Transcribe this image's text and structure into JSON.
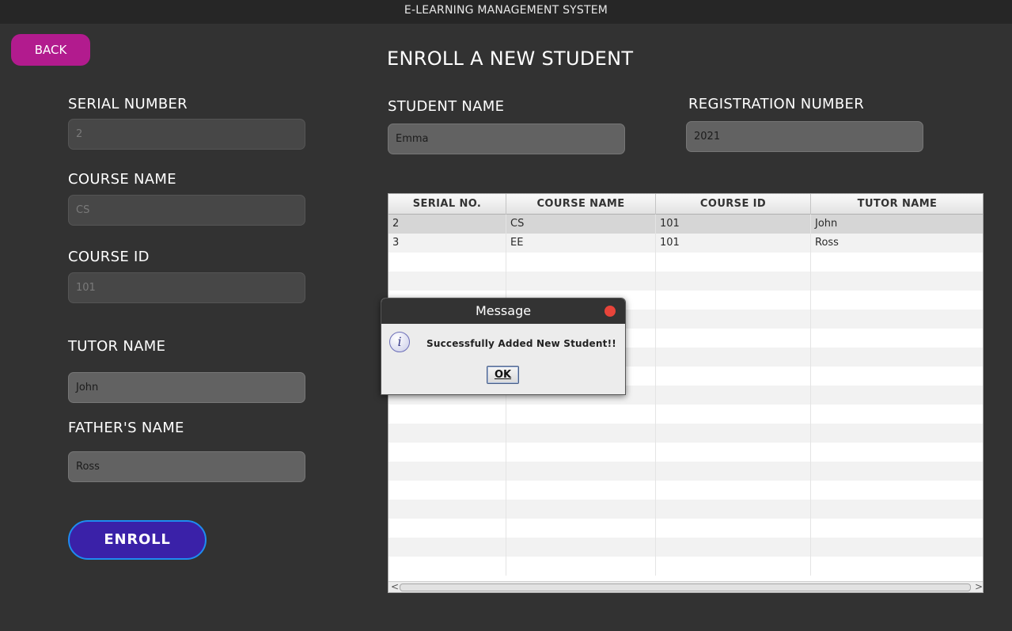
{
  "window": {
    "title": "E-LEARNING MANAGEMENT SYSTEM"
  },
  "back_label": "BACK",
  "page_title": "ENROLL A NEW STUDENT",
  "form": {
    "serial_number": {
      "label": "SERIAL NUMBER",
      "value": "2"
    },
    "course_name": {
      "label": "COURSE NAME",
      "value": "CS"
    },
    "course_id": {
      "label": "COURSE ID",
      "value": "101"
    },
    "tutor_name": {
      "label": "TUTOR NAME",
      "value": "John"
    },
    "fathers_name": {
      "label": "FATHER'S NAME",
      "value": "Ross"
    },
    "student_name": {
      "label": "STUDENT NAME",
      "value": "Emma"
    },
    "registration_number": {
      "label": "REGISTRATION NUMBER",
      "value": "2021"
    }
  },
  "enroll_label": "ENROLL",
  "table": {
    "columns": [
      "SERIAL NO.",
      "COURSE NAME",
      "COURSE ID",
      "TUTOR NAME"
    ],
    "rows": [
      [
        "2",
        "CS",
        "101",
        "John"
      ],
      [
        "3",
        "EE",
        "101",
        "Ross"
      ]
    ]
  },
  "scrollbar": {
    "left_arrow": "<",
    "right_arrow": ">"
  },
  "dialog": {
    "title": "Message",
    "icon": "info-icon",
    "icon_glyph": "i",
    "message": "Successfully Added New Student!!",
    "ok_label": "OK"
  },
  "colors": {
    "background": "#323232",
    "back_button": "#b21b8e",
    "enroll_button": "#3a21a8",
    "enroll_border": "#1e8cf0",
    "dialog_close": "#e8443a"
  }
}
